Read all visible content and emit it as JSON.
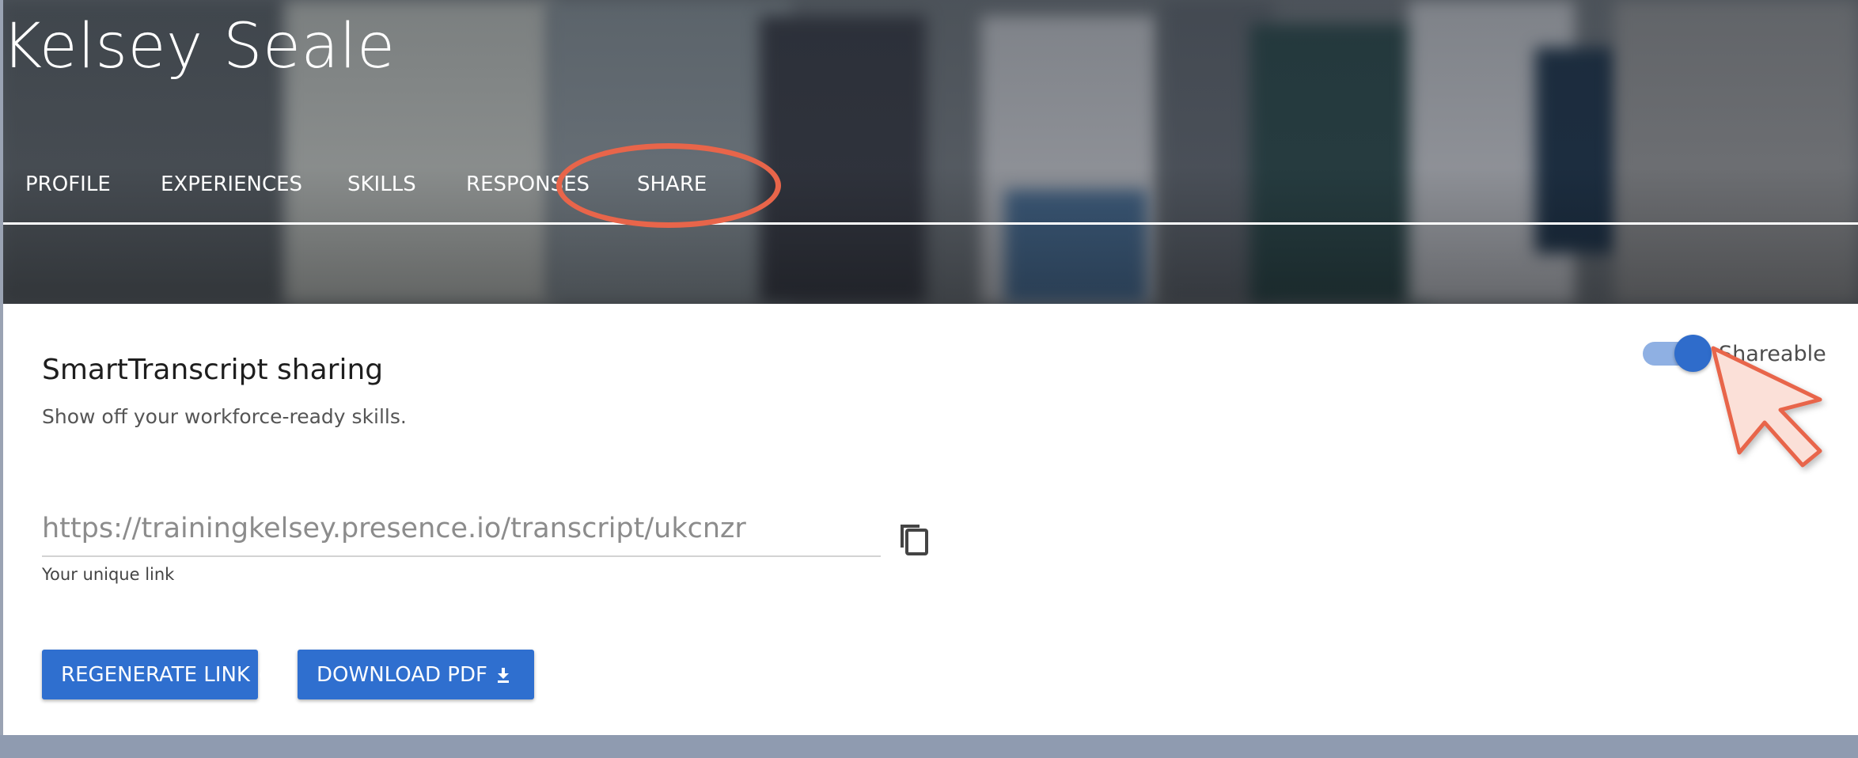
{
  "header": {
    "user_name": "Kelsey Seale",
    "nav": [
      {
        "label": "PROFILE"
      },
      {
        "label": "EXPERIENCES"
      },
      {
        "label": "SKILLS"
      },
      {
        "label": "RESPONSES"
      },
      {
        "label": "SHARE"
      }
    ],
    "active_tab": "SHARE"
  },
  "sharing": {
    "title": "SmartTranscript sharing",
    "subtitle": "Show off your workforce-ready skills.",
    "toggle_label": "Shareable",
    "toggle_on": true,
    "link_value": "https://trainingkelsey.presence.io/transcript/ukcnzr",
    "link_helper": "Your unique link",
    "copy_icon": "copy-icon",
    "regenerate_label": "REGENERATE LINK",
    "regenerate_icon": "refresh-icon",
    "download_label": "DOWNLOAD PDF",
    "download_icon": "download-icon"
  },
  "annotation": {
    "highlight_color": "#e8654a",
    "cursor_fill": "#fbe0d8"
  },
  "colors": {
    "primary": "#2f6fcf",
    "toggle_track": "#8fb0e3",
    "footer": "#8f9bb0"
  }
}
